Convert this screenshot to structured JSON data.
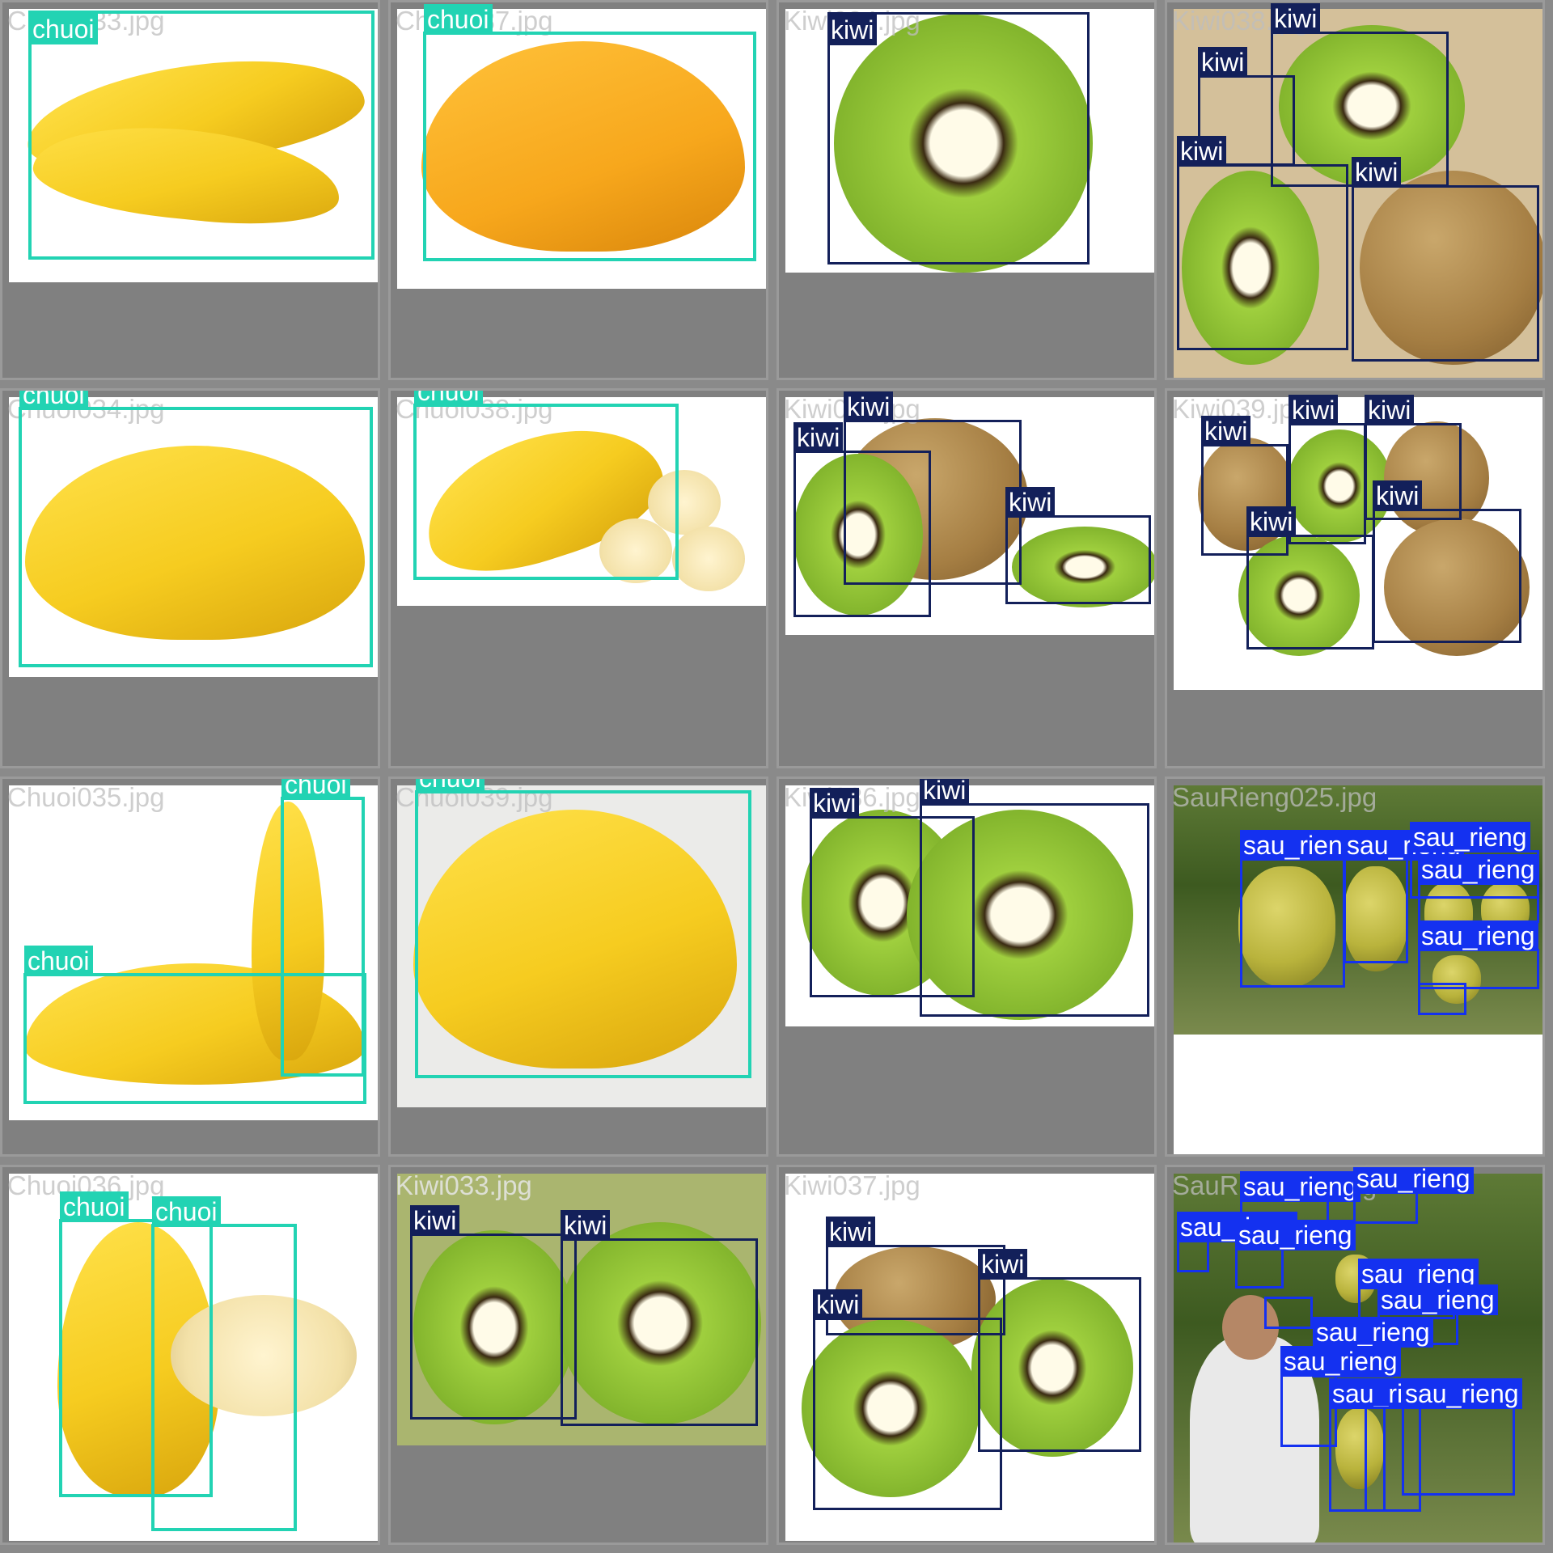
{
  "tiles": [
    {
      "filename": "Chuoi033.jpg",
      "labels": [
        "chuoi"
      ]
    },
    {
      "filename": "Chuoi037.jpg",
      "labels": [
        "chuoi"
      ]
    },
    {
      "filename": "Kiwi034.jpg",
      "labels": [
        "kiwi"
      ]
    },
    {
      "filename": "Kiwi038.jpg",
      "labels": [
        "kiwi",
        "kiwi",
        "kiwi",
        "kiwi"
      ]
    },
    {
      "filename": "Chuoi034.jpg",
      "labels": [
        "chuoi"
      ]
    },
    {
      "filename": "Chuoi038.jpg",
      "labels": [
        "chuoi"
      ]
    },
    {
      "filename": "Kiwi035.jpg",
      "labels": [
        "kiwi",
        "kiwi",
        "kiwi"
      ]
    },
    {
      "filename": "Kiwi039.jpg",
      "labels": [
        "kiwi",
        "kiwi",
        "kiwi",
        "kiwi",
        "kiwi"
      ]
    },
    {
      "filename": "Chuoi035.jpg",
      "labels": [
        "chuoi",
        "chuoi"
      ]
    },
    {
      "filename": "Chuoi039.jpg",
      "labels": [
        "chuoi"
      ]
    },
    {
      "filename": "Kiwi036.jpg",
      "labels": [
        "kiwi",
        "kiwi"
      ]
    },
    {
      "filename": "SauRieng025.jpg",
      "labels": [
        "sau_rieng",
        "sau_rieng",
        "sau_rieng",
        "sau_rieng",
        "sau_rieng",
        "sau_rieng"
      ]
    },
    {
      "filename": "Chuoi036.jpg",
      "labels": [
        "chuoi",
        "chuoi"
      ]
    },
    {
      "filename": "Kiwi033.jpg",
      "labels": [
        "kiwi",
        "kiwi"
      ]
    },
    {
      "filename": "Kiwi037.jpg",
      "labels": [
        "kiwi",
        "kiwi",
        "kiwi"
      ]
    },
    {
      "filename": "SauRieng026.jpg",
      "labels": [
        "sau_rieng",
        "sau_rieng",
        "sau_rieng",
        "sau_rieng",
        "sau_rieng",
        "sau_rieng",
        "sau_rieng",
        "sau_rieng",
        "sau_rieng",
        "sau_rieng",
        "sau_rieng",
        "sau_rieng"
      ]
    }
  ],
  "colors": {
    "chuoi": "#22d3b3",
    "kiwi": "#13205a",
    "sau_rieng": "#1431f0"
  }
}
